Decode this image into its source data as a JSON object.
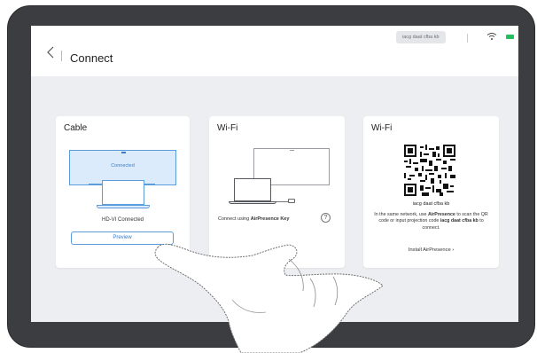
{
  "header": {
    "title": "Connect",
    "projection_code": "iacg daat cfba kb"
  },
  "status_bar": {
    "wifi_icon": "wifi-icon",
    "battery_color": "#20c15a"
  },
  "cards": {
    "cable": {
      "title": "Cable",
      "monitor_status": "Connected",
      "connection_status": "HD-VI Connected",
      "preview_label": "Preview"
    },
    "wifi_key": {
      "title": "Wi-Fi",
      "status_prefix": "Connect using ",
      "status_key": "AirPresence Key",
      "help_label": "?"
    },
    "wifi_qr": {
      "title": "Wi-Fi",
      "code": "iacg daat cfba kb",
      "desc_1": "In the same network, use ",
      "desc_app": "AirPresence",
      "desc_2": " to scan the QR code or input projection code ",
      "desc_code": "iacg daat cfba kb",
      "desc_3": " to connect.",
      "install_label": "Install AirPresence ›"
    }
  },
  "colors": {
    "accent": "#3a7bc8",
    "screen_bg": "#eceef1",
    "bezel": "#3b3d40"
  }
}
